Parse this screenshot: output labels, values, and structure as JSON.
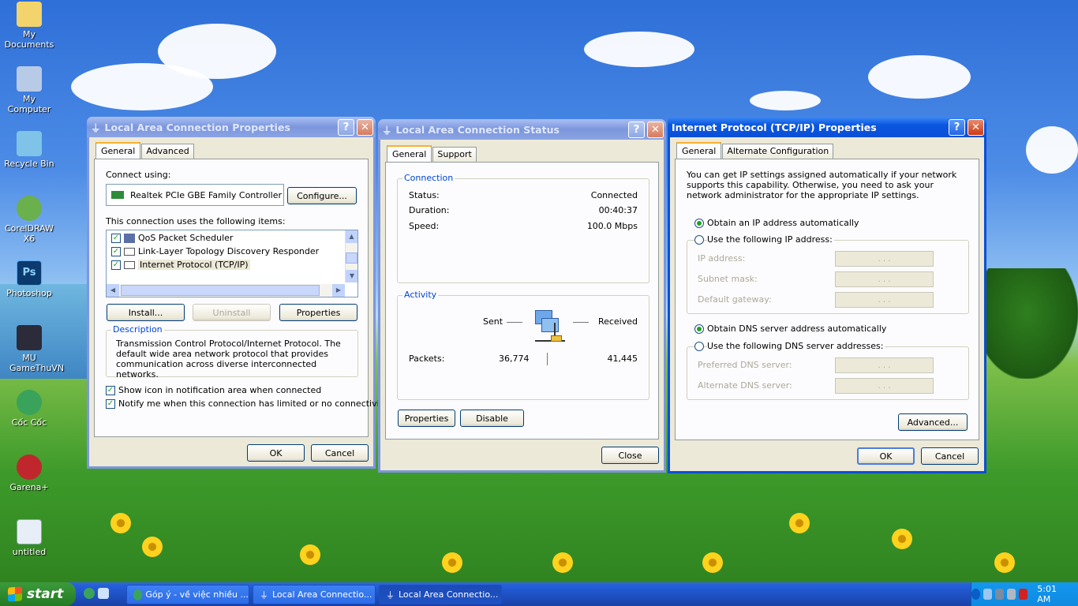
{
  "desktop": {
    "icons": [
      {
        "label": "My Documents",
        "icon": "my-documents-icon",
        "color": "#f3d36b"
      },
      {
        "label": "My Computer",
        "icon": "my-computer-icon",
        "color": "#b8cbe6"
      },
      {
        "label": "Recycle Bin",
        "icon": "recycle-bin-icon",
        "color": "#7fc4e8"
      },
      {
        "label": "CorelDRAW X6",
        "icon": "coreldraw-icon",
        "color": "#6ab04c"
      },
      {
        "label": "Photoshop",
        "icon": "photoshop-icon",
        "color": "#0b3a6e"
      },
      {
        "label": "MU GameThuVN",
        "icon": "mu-game-icon",
        "color": "#2b2b3a"
      },
      {
        "label": "Cốc Cốc",
        "icon": "coccoc-icon",
        "color": "#3aa35b"
      },
      {
        "label": "Garena+",
        "icon": "garena-icon",
        "color": "#c0272d"
      },
      {
        "label": "untitled",
        "icon": "document-icon",
        "color": "#e8eef8"
      }
    ]
  },
  "lac_props": {
    "title": "Local Area Connection Properties",
    "tabs": [
      "General",
      "Advanced"
    ],
    "connect_using_label": "Connect using:",
    "adapter": "Realtek PCIe GBE Family Controller",
    "configure": "Configure...",
    "items_label": "This connection uses the following items:",
    "items": [
      "QoS Packet Scheduler",
      "Link-Layer Topology Discovery Responder",
      "Internet Protocol (TCP/IP)"
    ],
    "install": "Install...",
    "uninstall": "Uninstall",
    "properties": "Properties",
    "description_title": "Description",
    "description": "Transmission Control Protocol/Internet Protocol. The default wide area network protocol that provides communication across diverse interconnected networks.",
    "show_icon": "Show icon in notification area when connected",
    "notify": "Notify me when this connection has limited or no connectivity",
    "ok": "OK",
    "cancel": "Cancel"
  },
  "lac_status": {
    "title": "Local Area Connection Status",
    "tabs": [
      "General",
      "Support"
    ],
    "connection_group": "Connection",
    "status_label": "Status:",
    "status_value": "Connected",
    "duration_label": "Duration:",
    "duration_value": "00:40:37",
    "speed_label": "Speed:",
    "speed_value": "100.0 Mbps",
    "activity_group": "Activity",
    "sent_label": "Sent",
    "received_label": "Received",
    "packets_label": "Packets:",
    "packets_sent": "36,774",
    "packets_received": "41,445",
    "properties": "Properties",
    "disable": "Disable",
    "close": "Close"
  },
  "tcpip": {
    "title": "Internet Protocol (TCP/IP) Properties",
    "tabs": [
      "General",
      "Alternate Configuration"
    ],
    "intro": "You can get IP settings assigned automatically if your network supports this capability. Otherwise, you need to ask your network administrator for the appropriate IP settings.",
    "obtain_ip": "Obtain an IP address automatically",
    "use_ip": "Use the following IP address:",
    "ip_address": "IP address:",
    "subnet_mask": "Subnet mask:",
    "default_gateway": "Default gateway:",
    "obtain_dns": "Obtain DNS server address automatically",
    "use_dns": "Use the following DNS server addresses:",
    "preferred_dns": "Preferred DNS server:",
    "alternate_dns": "Alternate DNS server:",
    "advanced": "Advanced...",
    "ok": "OK",
    "cancel": "Cancel",
    "dots": ". . ."
  },
  "taskbar": {
    "start": "start",
    "items": [
      "Góp ý - về việc nhiều ...",
      "Local Area Connectio...",
      "Local Area Connectio..."
    ],
    "clock": "5:01 AM"
  }
}
